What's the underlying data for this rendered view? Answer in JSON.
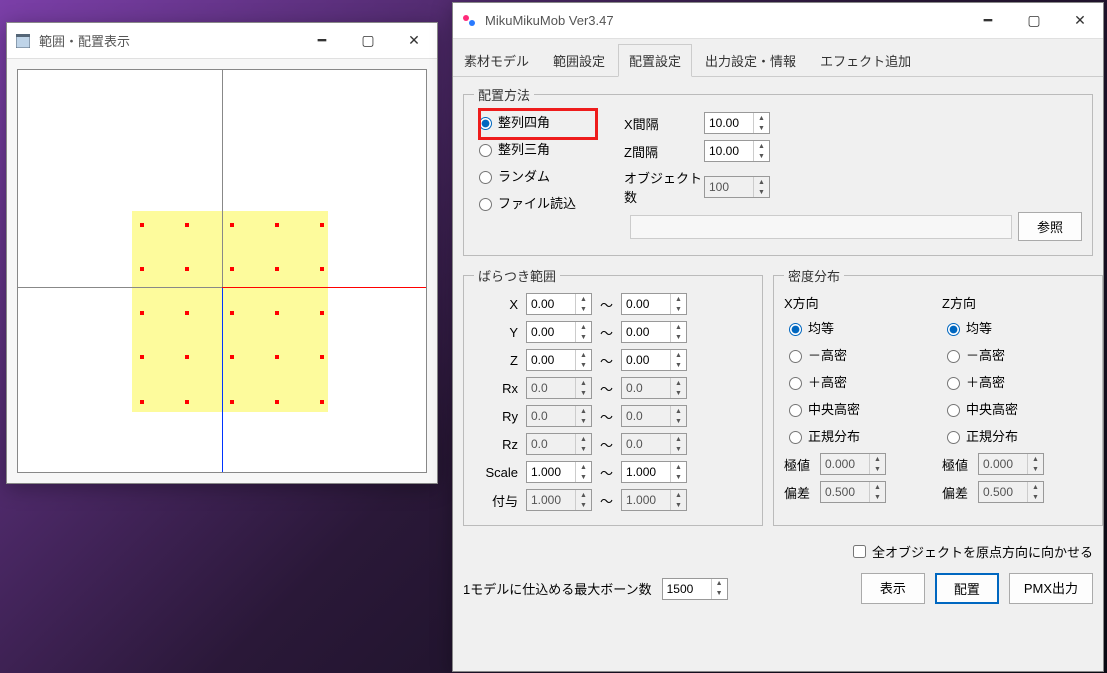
{
  "preview_window": {
    "title": "範囲・配置表示"
  },
  "main_window": {
    "title": "MikuMikuMob Ver3.47",
    "tabs": [
      "素材モデル",
      "範囲設定",
      "配置設定",
      "出力設定・情報",
      "エフェクト追加"
    ],
    "active_tab": 2
  },
  "placement_method": {
    "legend": "配置方法",
    "options": [
      "整列四角",
      "整列三角",
      "ランダム",
      "ファイル読込"
    ],
    "selected": 0,
    "x_interval_label": "X間隔",
    "x_interval": "10.00",
    "z_interval_label": "Z間隔",
    "z_interval": "10.00",
    "object_count_label": "オブジェクト数",
    "object_count": "100",
    "browse_label": "参照"
  },
  "variation": {
    "legend": "ばらつき範囲",
    "rows": [
      {
        "label": "X",
        "min": "0.00",
        "max": "0.00",
        "disabled": false
      },
      {
        "label": "Y",
        "min": "0.00",
        "max": "0.00",
        "disabled": false
      },
      {
        "label": "Z",
        "min": "0.00",
        "max": "0.00",
        "disabled": false
      },
      {
        "label": "Rx",
        "min": "0.0",
        "max": "0.0",
        "disabled": true
      },
      {
        "label": "Ry",
        "min": "0.0",
        "max": "0.0",
        "disabled": true
      },
      {
        "label": "Rz",
        "min": "0.0",
        "max": "0.0",
        "disabled": true
      },
      {
        "label": "Scale",
        "min": "1.000",
        "max": "1.000",
        "disabled": false
      },
      {
        "label": "付与",
        "min": "1.000",
        "max": "1.000",
        "disabled": true
      }
    ]
  },
  "density": {
    "legend": "密度分布",
    "x_legend": "X方向",
    "z_legend": "Z方向",
    "options": [
      "均等",
      "－高密",
      "＋高密",
      "中央高密",
      "正規分布"
    ],
    "selected_x": 0,
    "selected_z": 0,
    "extreme_label": "極値",
    "deviation_label": "偏差",
    "extreme_x": "0.000",
    "deviation_x": "0.500",
    "extreme_z": "0.000",
    "deviation_z": "0.500"
  },
  "face_origin_label": "全オブジェクトを原点方向に向かせる",
  "max_bones_label": "1モデルに仕込める最大ボーン数",
  "max_bones": "1500",
  "buttons": {
    "show": "表示",
    "place": "配置",
    "pmx": "PMX出力"
  }
}
